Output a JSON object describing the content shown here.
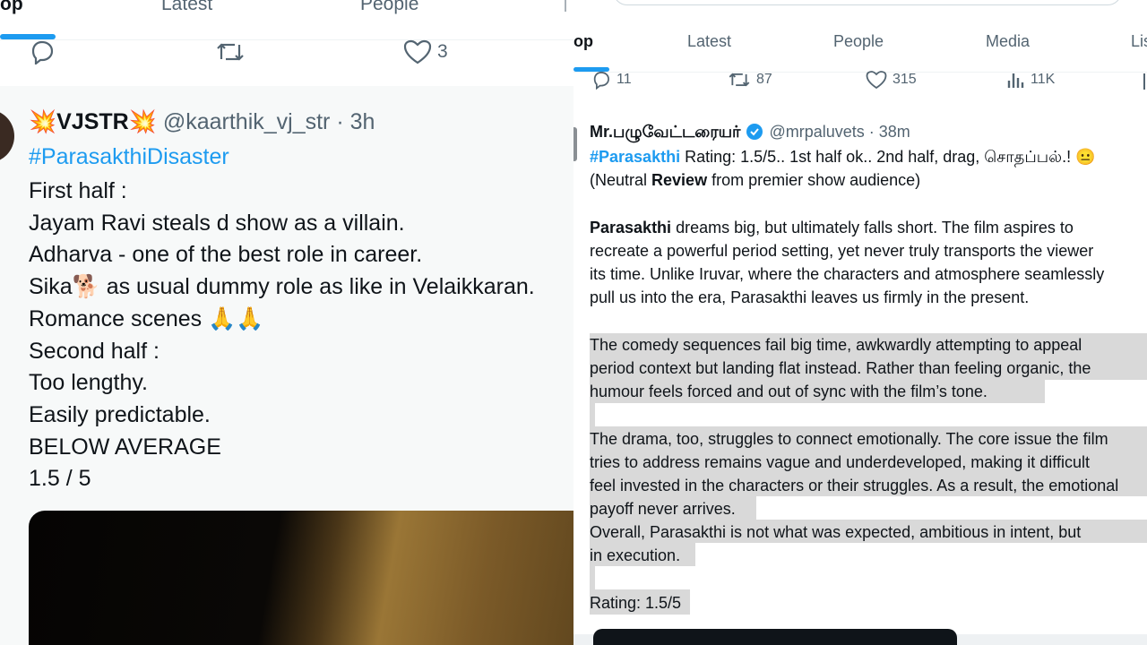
{
  "left": {
    "tabs": [
      "op",
      "Latest",
      "People"
    ],
    "stats": {
      "like_count": "3"
    },
    "tweet": {
      "badge_emoji": "💥",
      "author_name": "VJSTR",
      "handle_time": "@kaarthik_vj_str · 3h",
      "hashtag": "#ParasakthiDisaster",
      "lines": [
        "First half :",
        "Jayam Ravi steals d show as a villain.",
        "Adharva - one of the best role in career.",
        "Sika🐕 as usual dummy role as like in Velaikkaran.",
        "Romance scenes 🙏🙏",
        "Second half :",
        "Too lengthy.",
        "Easily predictable.",
        "BELOW AVERAGE",
        "1.5 / 5"
      ]
    }
  },
  "right": {
    "tabs": [
      "op",
      "Latest",
      "People",
      "Media",
      "Lis"
    ],
    "stats": {
      "replies": "11",
      "reposts": "87",
      "likes": "315",
      "views": "11K"
    },
    "tweet": {
      "author_name": "Mr.பழுவேட்டரையர்",
      "handle_time": "@mrpaluvets · 38m",
      "hashtag": "#Parasakthi",
      "line1_rest": " Rating: 1.5/5.. 1st half ok.. 2nd half, drag, சொதப்பல்.! 😐",
      "line2_a": "(Neutral ",
      "line2_b": "Review",
      "line2_c": " from premier show audience)",
      "p1_bold": "Parasakthi",
      "p1_l1_rest": " dreams big, but ultimately falls short. The film aspires to",
      "p1_l2": "recreate a powerful period setting, yet never truly transports the viewer",
      "p1_l3": "its time. Unlike Iruvar, where the characters and atmosphere seamlessly",
      "p1_l4": "pull us into the era, Parasakthi leaves us firmly in the present.",
      "p2_l1": "The comedy sequences fail big time, awkwardly attempting to appeal",
      "p2_l2": "period context but landing flat instead. Rather than feeling organic, the",
      "p2_l3": "humour feels forced and out of sync with the film’s tone.",
      "p3_l1": "The drama, too, struggles to connect emotionally. The core issue the film",
      "p3_l2": "tries to address remains vague and underdeveloped, making it difficult",
      "p3_l3": "feel invested in the characters or their struggles. As a result, the emotional",
      "p3_l4": "payoff never arrives.",
      "p4_l1": "Overall, Parasakthi is not what was expected, ambitious in intent, but",
      "p4_l2": "in execution.",
      "rating": "Rating: 1.5/5"
    }
  },
  "colors": {
    "accent": "#1d9bf0",
    "muted": "#536471",
    "highlight": "#d9d9d9",
    "verified": "#1d9bf0"
  }
}
